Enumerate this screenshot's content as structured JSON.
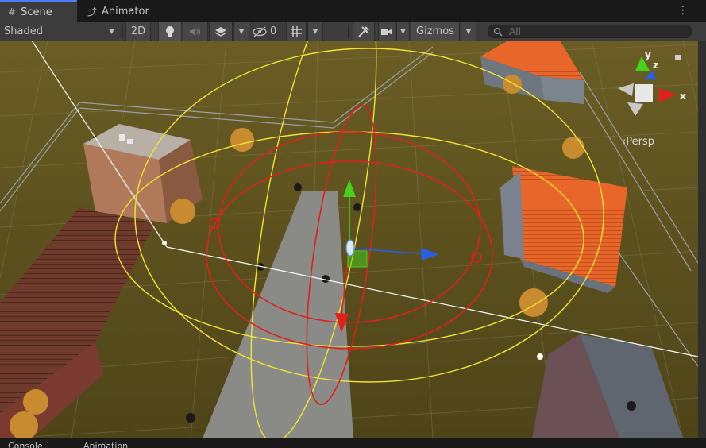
{
  "tabs": [
    {
      "label": "Scene",
      "icon": "grid-icon",
      "active": true
    },
    {
      "label": "Animator",
      "icon": "animator-icon",
      "active": false
    }
  ],
  "toolbar": {
    "shading_mode": "Shaded",
    "mode_2d": "2D",
    "hidden_count": "0",
    "gizmos_label": "Gizmos",
    "search_placeholder": "All"
  },
  "orientation_gizmo": {
    "x_label": "x",
    "y_label": "y",
    "z_label": "z",
    "projection_label": "Persp"
  },
  "bottom_tabs": [
    {
      "label": "Console"
    },
    {
      "label": "Animation"
    }
  ],
  "colors": {
    "accent_tab": "#4c7dff",
    "gizmo_x": "#e0201a",
    "gizmo_y": "#46d11a",
    "gizmo_z": "#2a5de8",
    "light_range": "#f2e433",
    "rotate_gizmo": "#e0201a"
  }
}
